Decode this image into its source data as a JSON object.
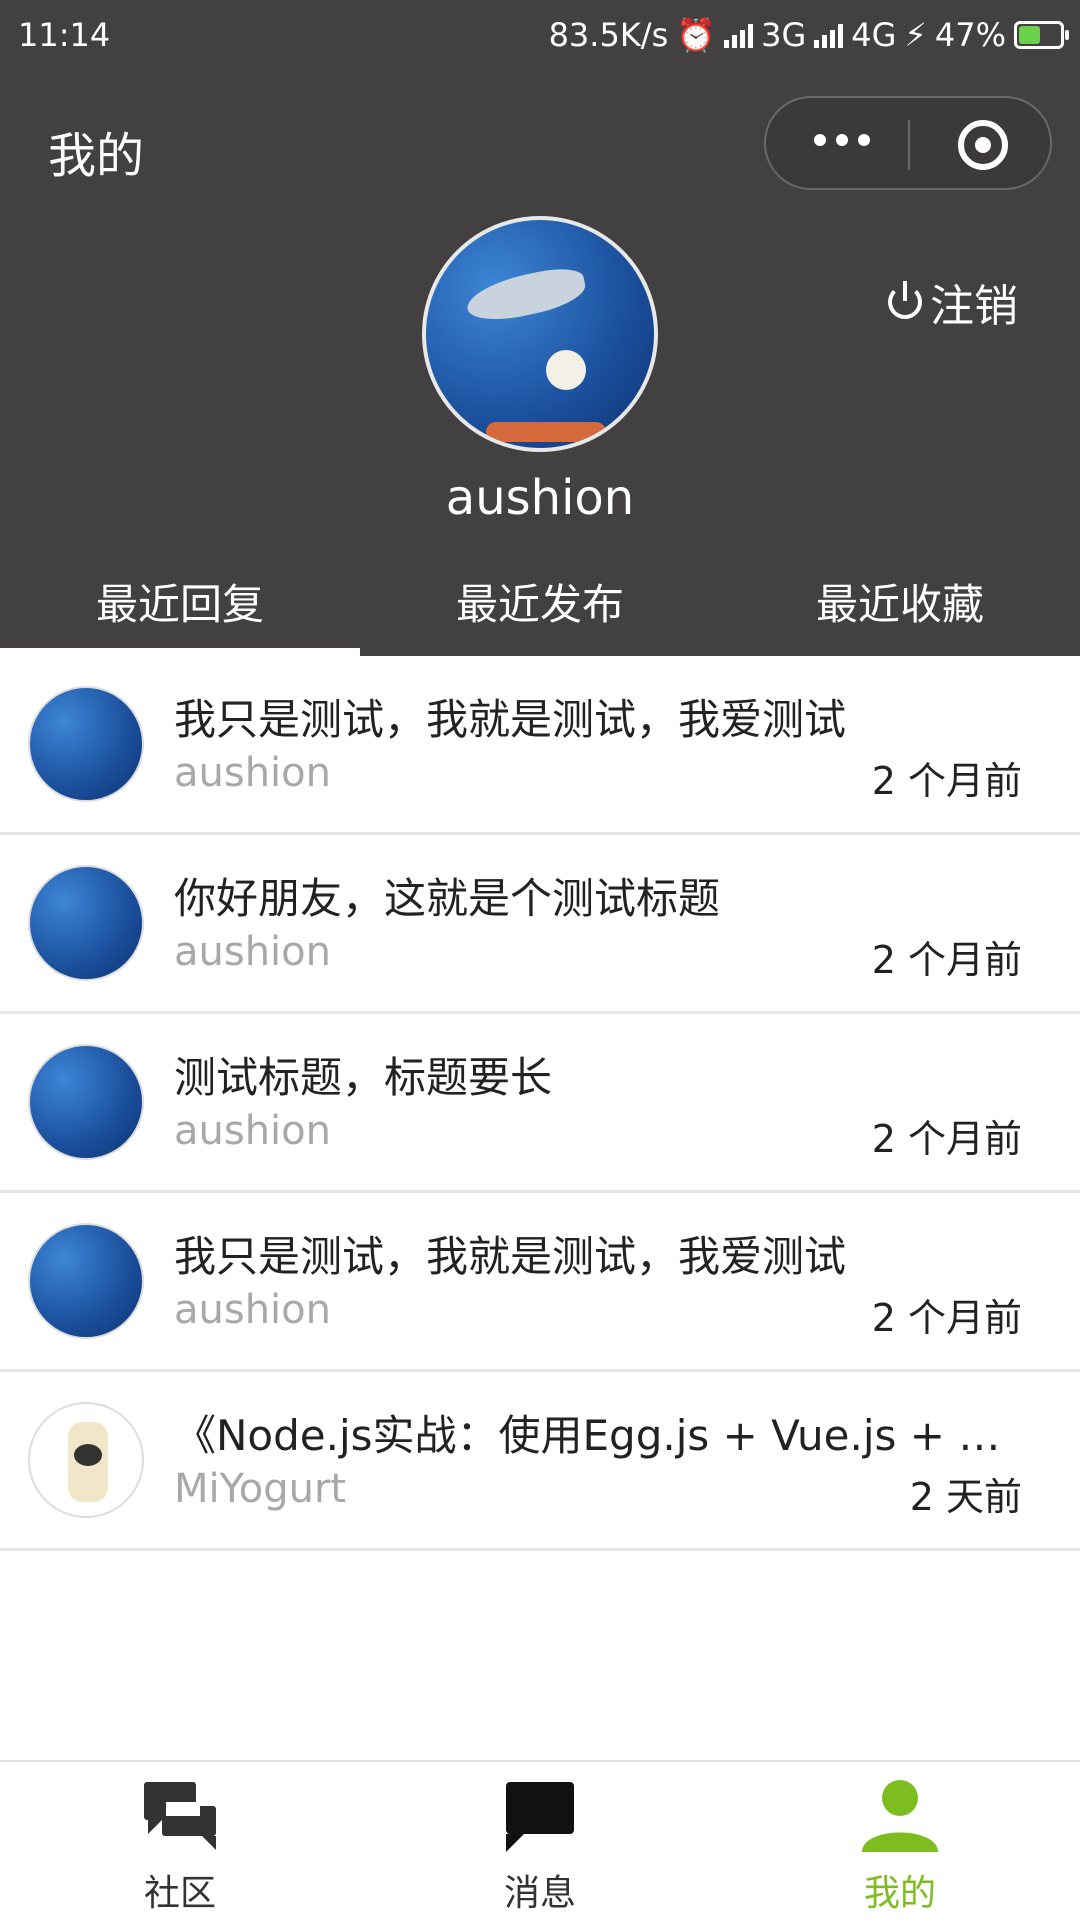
{
  "status_bar": {
    "time": "11:14",
    "speed": "83.5K/s",
    "net1": "3G",
    "net2": "4G",
    "battery": "47%"
  },
  "header": {
    "title": "我的",
    "username": "aushion",
    "logout_label": "注销"
  },
  "tabs": [
    {
      "label": "最近回复"
    },
    {
      "label": "最近发布"
    },
    {
      "label": "最近收藏"
    }
  ],
  "topics": [
    {
      "title": "我只是测试，我就是测试，我爱测试",
      "author": "aushion",
      "time": "2 个月前"
    },
    {
      "title": "你好朋友，这就是个测试标题",
      "author": "aushion",
      "time": "2 个月前"
    },
    {
      "title": "测试标题，标题要长",
      "author": "aushion",
      "time": "2 个月前"
    },
    {
      "title": "我只是测试，我就是测试，我爱测试",
      "author": "aushion",
      "time": "2 个月前"
    },
    {
      "title": "《Node.js实战：使用Egg.js + Vue.js + D...",
      "author": "MiYogurt",
      "time": "2 天前"
    }
  ],
  "tabbar": [
    {
      "label": "社区",
      "icon": "community-icon"
    },
    {
      "label": "消息",
      "icon": "message-icon"
    },
    {
      "label": "我的",
      "icon": "profile-icon"
    }
  ],
  "colors": {
    "header_bg": "#434041",
    "accent": "#7ebd1f"
  }
}
